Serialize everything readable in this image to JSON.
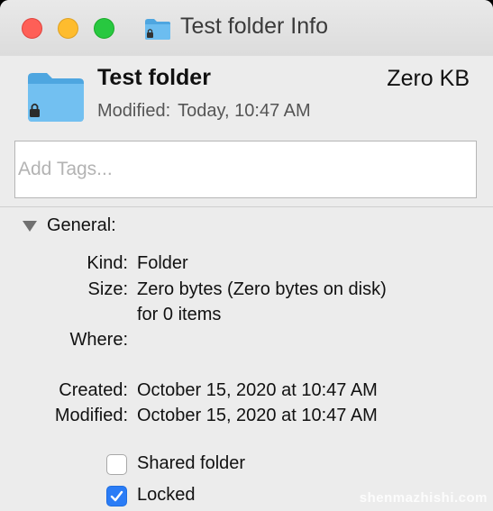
{
  "window": {
    "title": "Test folder Info"
  },
  "header": {
    "name": "Test folder",
    "size": "Zero KB",
    "modified_label": "Modified:",
    "modified_value": "Today, 10:47 AM"
  },
  "tags": {
    "placeholder": "Add Tags..."
  },
  "general": {
    "section_label": "General:",
    "rows": {
      "kind_label": "Kind:",
      "kind_value": "Folder",
      "size_label": "Size:",
      "size_value": "Zero bytes (Zero bytes on disk)",
      "size_value_line2": "for 0 items",
      "where_label": "Where:",
      "where_value": "",
      "created_label": "Created:",
      "created_value": "October 15, 2020 at 10:47 AM",
      "modified_label": "Modified:",
      "modified_value": "October 15, 2020 at 10:47 AM"
    },
    "checkboxes": {
      "shared_label": "Shared folder",
      "shared_checked": false,
      "locked_label": "Locked",
      "locked_checked": true
    }
  },
  "watermark": "shenmazhishi.com",
  "colors": {
    "folder": "#5fb6ec",
    "checkbox_accent": "#2a7cf6",
    "close": "#fe5f57",
    "minimize": "#febc2e",
    "zoom": "#28c840"
  },
  "icons": {
    "folder": "locked-folder-icon",
    "disclosure": "disclosure-triangle-icon",
    "check": "checkmark-icon"
  }
}
